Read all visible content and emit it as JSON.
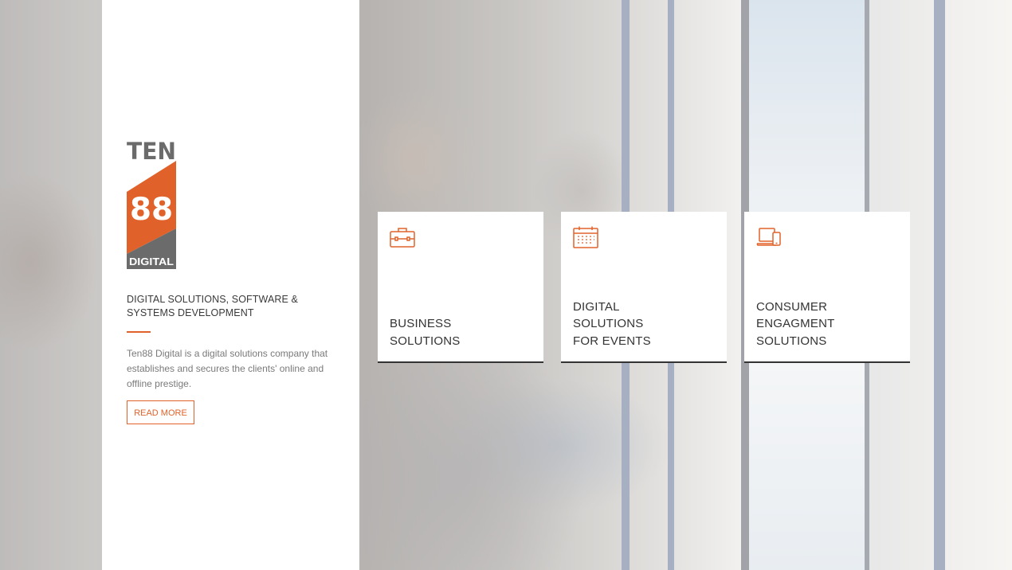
{
  "colors": {
    "accent": "#e0622a",
    "logo_grey": "#6b6b6b",
    "card_border": "#333333"
  },
  "brand": {
    "logo_top": "TEN",
    "logo_mid": "88",
    "logo_bottom": "DIGITAL"
  },
  "intro": {
    "tagline": "DIGITAL SOLUTIONS, SOFTWARE & SYSTEMS DEVELOPMENT",
    "description": "Ten88 Digital is a digital solutions company that establishes and secures the clients' online and offline prestige.",
    "read_more_label": "READ MORE"
  },
  "services": [
    {
      "icon": "briefcase-icon",
      "lines": [
        "BUSINESS",
        "SOLUTIONS"
      ]
    },
    {
      "icon": "calendar-icon",
      "lines": [
        "DIGITAL",
        "SOLUTIONS",
        "FOR EVENTS"
      ]
    },
    {
      "icon": "devices-icon",
      "lines": [
        "CONSUMER",
        "ENGAGMENT",
        "SOLUTIONS"
      ]
    }
  ]
}
